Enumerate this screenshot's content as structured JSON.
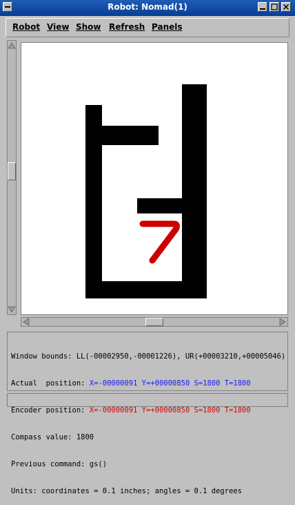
{
  "window": {
    "title": "Robot: Nomad(1)",
    "buttons": [
      "minimize",
      "maximize",
      "close"
    ]
  },
  "menu": {
    "items": [
      "Robot",
      "View",
      "Show",
      "Refresh",
      "Panels"
    ]
  },
  "canvas": {
    "obstacle_color": "#000000",
    "robot_color": "#cc0000",
    "robot_label": "7"
  },
  "status": {
    "window_bounds": "Window bounds: LL(-00002950,-00001226), UR(+00003210,+00005046)",
    "actual_label": "Actual  position: ",
    "actual_value": "X=-00000091 Y=+00000850 S=1800 T=1800",
    "encoder_label": "Encoder position: ",
    "encoder_value": "X=-00000091 Y=+00000850 S=1800 T=1800",
    "compass": "Compass value: 1800",
    "previous": "Previous command: gs()",
    "units": "Units: coordinates = 0.1 inches; angles = 0.1 degrees"
  },
  "colors": {
    "actual": "#1a1aff",
    "encoder": "#e00000"
  }
}
